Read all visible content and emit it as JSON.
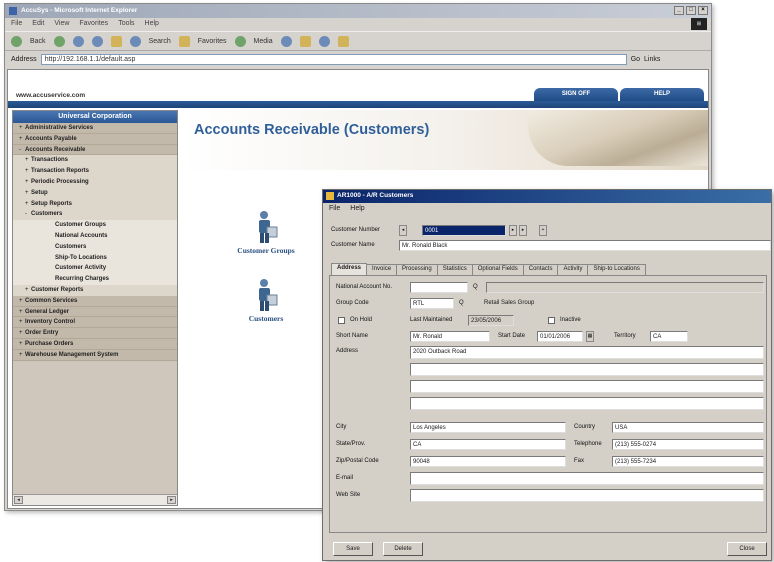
{
  "browser": {
    "title": "AccuSys - Microsoft Internet Explorer",
    "menu": [
      "File",
      "Edit",
      "View",
      "Favorites",
      "Tools",
      "Help"
    ],
    "toolbar": [
      "Back",
      "Search",
      "Favorites",
      "Media"
    ],
    "address_label": "Address",
    "address_value": "http://192.168.1.1/default.asp",
    "go_label": "Go",
    "links_label": "Links"
  },
  "site": {
    "url": "www.accuservice.com",
    "nav": [
      "SIGN OFF",
      "HELP"
    ]
  },
  "sidebar": {
    "header": "Universal Corporation",
    "items": [
      {
        "label": "Administrative Services",
        "level": 0,
        "exp": "+"
      },
      {
        "label": "Accounts Payable",
        "level": 0,
        "exp": "+"
      },
      {
        "label": "Accounts Receivable",
        "level": 0,
        "exp": "-"
      },
      {
        "label": "Transactions",
        "level": 1,
        "exp": "+"
      },
      {
        "label": "Transaction Reports",
        "level": 1,
        "exp": "+"
      },
      {
        "label": "Periodic Processing",
        "level": 1,
        "exp": "+"
      },
      {
        "label": "Setup",
        "level": 1,
        "exp": "+"
      },
      {
        "label": "Setup Reports",
        "level": 1,
        "exp": "+"
      },
      {
        "label": "Customers",
        "level": 1,
        "exp": "-"
      },
      {
        "label": "Customer Groups",
        "level": 2,
        "exp": ""
      },
      {
        "label": "National Accounts",
        "level": 2,
        "exp": ""
      },
      {
        "label": "Customers",
        "level": 2,
        "exp": ""
      },
      {
        "label": "Ship-To Locations",
        "level": 2,
        "exp": ""
      },
      {
        "label": "Customer Activity",
        "level": 2,
        "exp": ""
      },
      {
        "label": "Recurring Charges",
        "level": 2,
        "exp": ""
      },
      {
        "label": "Customer Reports",
        "level": 1,
        "exp": "+"
      },
      {
        "label": "Common Services",
        "level": 0,
        "exp": "+"
      },
      {
        "label": "General Ledger",
        "level": 0,
        "exp": "+"
      },
      {
        "label": "Inventory Control",
        "level": 0,
        "exp": "+"
      },
      {
        "label": "Order Entry",
        "level": 0,
        "exp": "+"
      },
      {
        "label": "Purchase Orders",
        "level": 0,
        "exp": "+"
      },
      {
        "label": "Warehouse Management System",
        "level": 0,
        "exp": "+"
      }
    ]
  },
  "main": {
    "title": "Accounts Receivable (Customers)",
    "icons": [
      {
        "label": "Customer Groups"
      },
      {
        "label": "Customers"
      }
    ]
  },
  "dialog": {
    "title": "AR1000 - A/R Customers",
    "menu": [
      "File",
      "Help"
    ],
    "customer_number_label": "Customer Number",
    "customer_number_value": "0001",
    "customer_name_label": "Customer Name",
    "customer_name_value": "Mr. Ronald Black",
    "tabs": [
      "Address",
      "Invoice",
      "Processing",
      "Statistics",
      "Optional Fields",
      "Contacts",
      "Activity",
      "Ship-to Locations"
    ],
    "national_account_label": "National Account No.",
    "group_code_label": "Group Code",
    "group_code_value": "RTL",
    "group_code_desc": "Retail Sales Group",
    "on_hold_label": "On Hold",
    "last_maintained_label": "Last Maintained",
    "last_maintained_value": "23/05/2006",
    "inactive_label": "Inactive",
    "short_name_label": "Short Name",
    "short_name_value": "Mr. Ronald",
    "start_date_label": "Start Date",
    "start_date_value": "01/01/2006",
    "territory_label": "Territory",
    "territory_value": "CA",
    "address_label": "Address",
    "address_lines": [
      "2020 Outback Road",
      "",
      "",
      ""
    ],
    "city_label": "City",
    "city_value": "Los Angeles",
    "state_label": "State/Prov.",
    "state_value": "CA",
    "zip_label": "Zip/Postal Code",
    "zip_value": "90048",
    "country_label": "Country",
    "country_value": "USA",
    "telephone_label": "Telephone",
    "telephone_value": "(213) 555-0274",
    "fax_label": "Fax",
    "fax_value": "(213) 555-7234",
    "email_label": "E-mail",
    "email_value": "",
    "website_label": "Web Site",
    "website_value": "",
    "buttons": {
      "save": "Save",
      "delete": "Delete",
      "close": "Close"
    }
  }
}
